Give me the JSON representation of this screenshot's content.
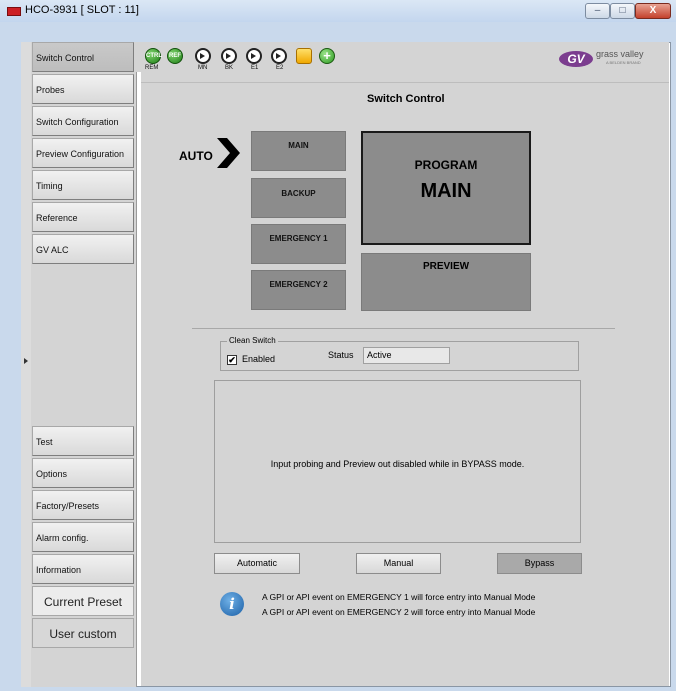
{
  "window": {
    "title": "HCO-3931 [ SLOT : 11]",
    "minimize_glyph": "–",
    "maximize_glyph": "□",
    "close_glyph": "X"
  },
  "sidebar": {
    "items": [
      {
        "label": "Switch Control",
        "active": true
      },
      {
        "label": "Probes"
      },
      {
        "label": "Switch Configuration"
      },
      {
        "label": "Preview Configuration"
      },
      {
        "label": "Timing"
      },
      {
        "label": "Reference"
      },
      {
        "label": "GV ALC"
      }
    ],
    "lower_items": [
      {
        "label": "Test"
      },
      {
        "label": "Options"
      },
      {
        "label": "Factory/Presets"
      },
      {
        "label": "Alarm config."
      },
      {
        "label": "Information"
      }
    ],
    "preset_label": "Current Preset",
    "preset_value": "User custom"
  },
  "toolbar": {
    "icons": [
      {
        "name": "ctrl-icon",
        "glyph": "CTRL",
        "label": "REM"
      },
      {
        "name": "ref-icon",
        "glyph": "REF",
        "label": ""
      },
      {
        "name": "main-arrow-icon",
        "label": "MN"
      },
      {
        "name": "backup-arrow-icon",
        "label": "BK"
      },
      {
        "name": "emergency1-arrow-icon",
        "label": "E1"
      },
      {
        "name": "emergency2-arrow-icon",
        "label": "E2"
      },
      {
        "name": "status-yellow-icon",
        "label": ""
      },
      {
        "name": "add-icon",
        "glyph": "+",
        "label": ""
      }
    ]
  },
  "logo": {
    "mark": "GV",
    "text": "grass valley",
    "sub": "A BELDEN BRAND"
  },
  "switch_control": {
    "title": "Switch Control",
    "auto_label": "AUTO",
    "sources": [
      "MAIN",
      "BACKUP",
      "EMERGENCY 1",
      "EMERGENCY 2"
    ],
    "program_label": "PROGRAM",
    "program_value": "MAIN",
    "preview_label": "PREVIEW"
  },
  "clean_switch": {
    "title": "Clean Switch",
    "enabled_label": "Enabled",
    "enabled_checked": "✔",
    "status_label": "Status",
    "status_value": "Active"
  },
  "message": "Input probing and Preview out disabled while in BYPASS mode.",
  "modes": [
    "Automatic",
    "Manual",
    "Bypass"
  ],
  "info_glyph": "i",
  "notes": [
    "A GPI or API event on EMERGENCY 1 will force entry into Manual Mode",
    "A GPI or API event on EMERGENCY 2 will force entry into Manual Mode"
  ],
  "colors": {
    "panel": "#d4d4d4",
    "source_button": "#8c8c8c",
    "logo": "#7b3d8f",
    "app_icon": "#cc1f24"
  }
}
